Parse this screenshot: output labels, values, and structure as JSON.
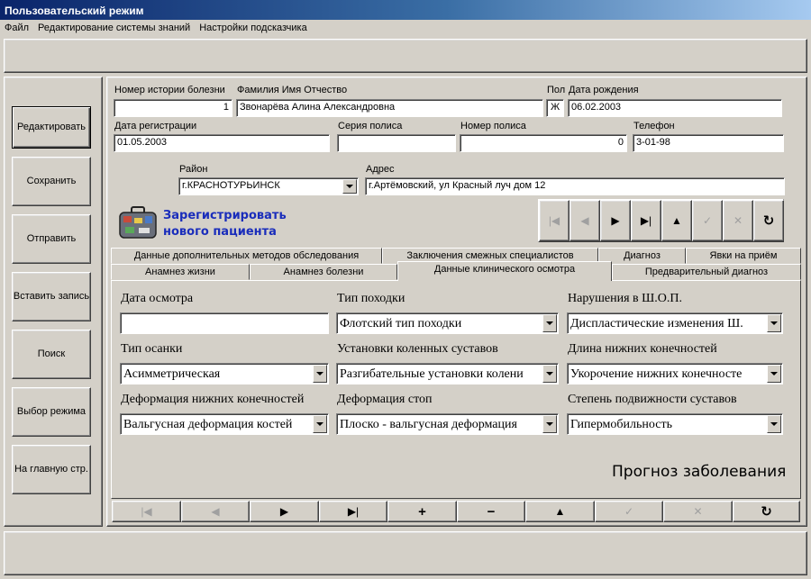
{
  "window": {
    "title": "Пользовательский режим"
  },
  "menu": [
    "Файл",
    "Редактирование системы знаний",
    "Настройки подсказчика"
  ],
  "sidebar": {
    "buttons": [
      "Редактировать",
      "Сохранить",
      "Отправить",
      "Вставить запись",
      "Поиск",
      "Выбор режима",
      "На главную стр."
    ]
  },
  "patient": {
    "history_label": "Номер истории болезни",
    "history_value": "1",
    "name_label": "Фамилия Имя Отчество",
    "name_value": "Звонарёва Алина Александровна",
    "sex_label": "Пол",
    "sex_value": "Ж",
    "birth_label": "Дата рождения",
    "birth_value": "06.02.2003",
    "reg_label": "Дата регистрации",
    "reg_value": "01.05.2003",
    "policy_series_label": "Серия полиса",
    "policy_series_value": "",
    "policy_number_label": "Номер полиса",
    "policy_number_value": "0",
    "phone_label": "Телефон",
    "phone_value": "3-01-98",
    "district_label": "Район",
    "district_value": "г.КРАСНОТУРЬИНСК",
    "address_label": "Адрес",
    "address_value": "г.Артёмовский, ул Красный луч дом 12"
  },
  "register": {
    "label": "Зарегистрировать нового пациента",
    "line1": "Зарегистрировать",
    "line2": "нового пациента"
  },
  "tabs": {
    "row1": [
      "Данные дополнительных методов обследования",
      "Заключения смежных специалистов",
      "Диагноз",
      "Явки на приём"
    ],
    "row2": [
      "Анамнез жизни",
      "Анамнез болезни",
      "Данные клинического осмотра",
      "Предварительный диагноз"
    ],
    "active": "Данные клинического осмотра"
  },
  "exam": {
    "exam_date_label": "Дата осмотра",
    "exam_date_value": "",
    "gait_label": "Тип походки",
    "gait_value": "Флотский тип походки",
    "spine_label": "Нарушения в Ш.О.П.",
    "spine_value": "Диспластические изменения Ш.",
    "posture_label": "Тип осанки",
    "posture_value": "Асимметрическая",
    "knee_label": "Установки коленных суставов",
    "knee_value": "Разгибательные установки колени",
    "leg_length_label": "Длина нижних конечностей",
    "leg_length_value": "Укорочение нижних конечносте",
    "leg_deform_label": "Деформация нижних конечностей",
    "leg_deform_value": "Вальгусная деформация костей",
    "foot_deform_label": "Деформация стоп",
    "foot_deform_value": "Плоско - вальгусная деформация",
    "mobility_label": "Степень подвижности суставов",
    "mobility_value": "Гипермобильность"
  },
  "forecast": {
    "label": "Прогноз заболевания"
  },
  "icons": {
    "top_nav": [
      "first-icon",
      "prior-icon",
      "next-icon",
      "last-icon",
      "insert-icon",
      "post-icon",
      "cancel-icon",
      "refresh-icon"
    ],
    "bottom_nav": [
      "first-icon",
      "prior-icon",
      "next-icon",
      "last-icon",
      "insert-icon",
      "delete-icon",
      "edit-icon",
      "post-icon",
      "cancel-icon",
      "refresh-icon"
    ]
  },
  "colors": {
    "title_gradient_start": "#0a246a",
    "title_gradient_end": "#a6caf0",
    "register_link": "#1a2dbb",
    "face": "#d4d0c8"
  }
}
